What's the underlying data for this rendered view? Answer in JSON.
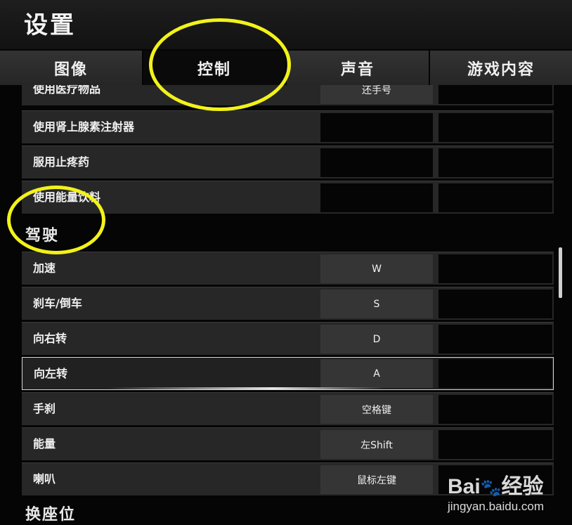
{
  "header": {
    "title": "设置"
  },
  "tabs": [
    {
      "label": "图像",
      "active": false
    },
    {
      "label": "控制",
      "active": true
    },
    {
      "label": "声音",
      "active": false
    },
    {
      "label": "游戏内容",
      "active": false
    }
  ],
  "items_section": {
    "rows": [
      {
        "action": "使用医疗物品",
        "key1": "还手号",
        "key2": ""
      },
      {
        "action": "使用肾上腺素注射器",
        "key1": "",
        "key2": ""
      },
      {
        "action": "服用止疼药",
        "key1": "",
        "key2": ""
      },
      {
        "action": "使用能量饮料",
        "key1": "",
        "key2": ""
      }
    ]
  },
  "driving_section": {
    "title": "驾驶",
    "rows": [
      {
        "action": "加速",
        "key1": "W",
        "key2": ""
      },
      {
        "action": "刹车/倒车",
        "key1": "S",
        "key2": ""
      },
      {
        "action": "向右转",
        "key1": "D",
        "key2": ""
      },
      {
        "action": "向左转",
        "key1": "A",
        "key2": "",
        "selected": true
      },
      {
        "action": "手刹",
        "key1": "空格键",
        "key2": ""
      },
      {
        "action": "能量",
        "key1": "左Shift",
        "key2": ""
      },
      {
        "action": "喇叭",
        "key1": "鼠标左键",
        "key2": ""
      }
    ]
  },
  "seat_section": {
    "title": "换座位"
  },
  "watermark": {
    "logo": "Bai",
    "logo_suffix": "经验",
    "url": "jingyan.baidu.com"
  },
  "colors": {
    "annotation": "#f2f21a",
    "background": "#050505",
    "row": "#272727"
  }
}
